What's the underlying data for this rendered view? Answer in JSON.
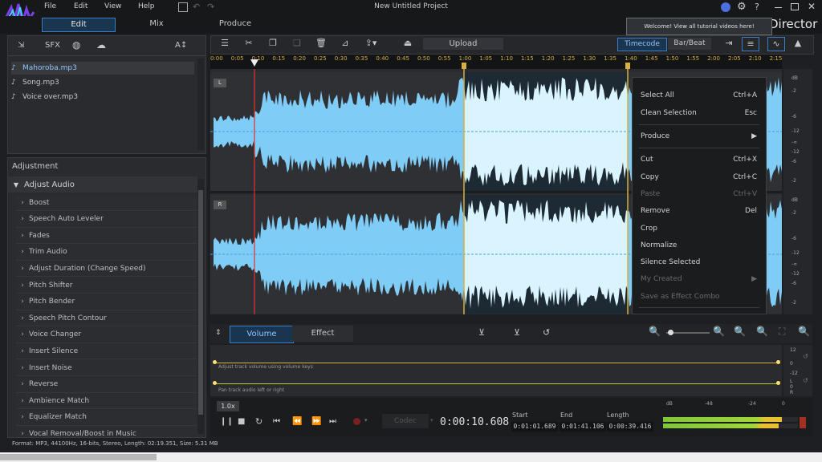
{
  "menu": [
    "File",
    "Edit",
    "View",
    "Help"
  ],
  "window_title": "New Untitled Project",
  "modes": [
    "Edit",
    "Mix",
    "Produce"
  ],
  "brand": "Director",
  "tooltip": "Welcome! View all tutorial videos here!",
  "left_tools": [
    "SFX",
    "A↕"
  ],
  "files": [
    "Mahoroba.mp3",
    "Song.mp3",
    "Voice over.mp3"
  ],
  "adjustment": {
    "header": "Adjustment",
    "group": "Adjust Audio",
    "items": [
      "Boost",
      "Speech Auto Leveler",
      "Fades",
      "Trim Audio",
      "Adjust Duration (Change Speed)",
      "Pitch Shifter",
      "Pitch Bender",
      "Speech Pitch Contour",
      "Voice Changer",
      "Insert Silence",
      "Insert Noise",
      "Reverse",
      "Ambience Match",
      "Equalizer Match",
      "Vocal Removal/Boost in Music"
    ]
  },
  "toolbar": {
    "upload": "Upload",
    "timecode": "Timecode",
    "barbeat": "Bar/Beat"
  },
  "ruler": [
    "0:00",
    "0:05",
    "0:10",
    "0:15",
    "0:20",
    "0:25",
    "0:30",
    "0:35",
    "0:40",
    "0:45",
    "0:50",
    "0:55",
    "1:00",
    "1:05",
    "1:10",
    "1:15",
    "1:20",
    "1:25",
    "1:30",
    "1:35",
    "1:40",
    "1:45",
    "1:50",
    "1:55",
    "2:00",
    "2:05",
    "2:10",
    "2:15"
  ],
  "channels": [
    "L",
    "R"
  ],
  "db_scale": [
    "dB",
    "-2",
    "-6",
    "-12",
    "-∞",
    "-12",
    "-6",
    "-2"
  ],
  "context_menu": [
    {
      "label": "Select All",
      "key": "Ctrl+A",
      "enabled": true
    },
    {
      "label": "Clean Selection",
      "key": "Esc",
      "enabled": true
    },
    {
      "label": "Produce",
      "key": "▶",
      "enabled": true
    },
    {
      "label": "Cut",
      "key": "Ctrl+X",
      "enabled": true
    },
    {
      "label": "Copy",
      "key": "Ctrl+C",
      "enabled": true
    },
    {
      "label": "Paste",
      "key": "Ctrl+V",
      "enabled": false
    },
    {
      "label": "Remove",
      "key": "Del",
      "enabled": true
    },
    {
      "label": "Crop",
      "key": "",
      "enabled": true
    },
    {
      "label": "Normalize",
      "key": "",
      "enabled": true
    },
    {
      "label": "Silence Selected",
      "key": "",
      "enabled": true
    },
    {
      "label": "My Created",
      "key": "▶",
      "enabled": false
    },
    {
      "label": "Save as Effect Combo",
      "key": "",
      "enabled": false
    }
  ],
  "lower_tabs": [
    "Volume",
    "Effect"
  ],
  "volume_hint": "Adjust track volume using volume keys",
  "pan_hint": "Pan track audio left or right",
  "right_scale": [
    "12",
    "0",
    "-12",
    "L",
    "0",
    "R"
  ],
  "transport": {
    "speed": "1.0x",
    "codec": "Codec",
    "time": "0:00:10.608",
    "start_label": "Start",
    "start": "0:01:01.689",
    "end_label": "End",
    "end": "0:01:41.106",
    "length_label": "Length",
    "length": "0:00:39.416"
  },
  "meter_labels": [
    "dB",
    "-48",
    "-24",
    "0"
  ],
  "meter_levels": [
    0.88,
    0.86
  ],
  "status": "Format: MP3, 44100Hz, 16-bits, Stereo, Length: 02:19.351, Size: 5.31 MB",
  "colors": {
    "accent": "#3a7fc2",
    "wave": "#7fcdf7",
    "wave_sel": "#d9f3ff",
    "playhead": "#e03030",
    "ruler_text": "#d8b040"
  }
}
